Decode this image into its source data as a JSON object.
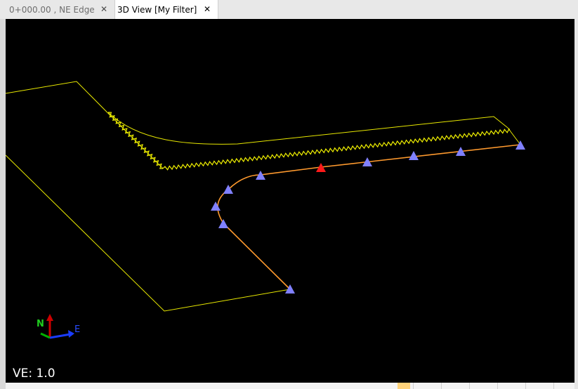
{
  "tabs": [
    {
      "label": "0+000.00 , NE Edge",
      "close_glyph": "✕",
      "active": false
    },
    {
      "label": "3D View [My Filter]",
      "close_glyph": "✕",
      "active": true
    }
  ],
  "viewport": {
    "ve_label": "VE: 1.0",
    "axis": {
      "north_label": "N",
      "east_label": "E"
    }
  },
  "colors": {
    "background": "#000000",
    "boundary_line": "#e8e800",
    "alignment_line": "#ff9a2e",
    "vertex_marker": "#8080ff",
    "selected_marker": "#ff1a1a",
    "axis_north": "#cc0000",
    "axis_east": "#1a3cff",
    "axis_vertical": "#00b000"
  },
  "icons": [
    "close-icon",
    "axis-triad-icon",
    "triangle-marker-icon"
  ]
}
